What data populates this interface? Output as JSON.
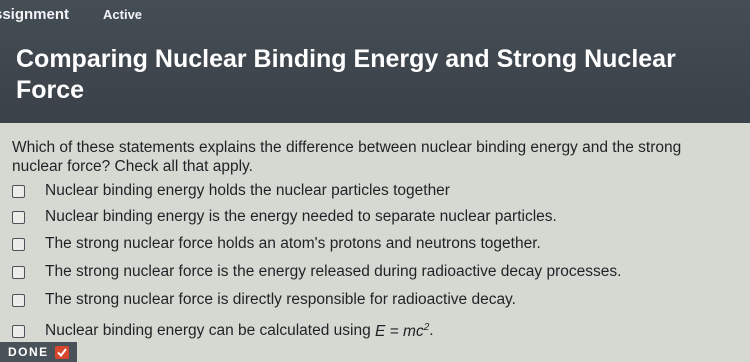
{
  "header": {
    "breadcrumb": "ssignment",
    "status": "Active",
    "title": "Comparing Nuclear Binding Energy and Strong Nuclear Force"
  },
  "question": "Which of these statements explains the difference between nuclear binding energy and the strong nuclear force? Check all that apply.",
  "options": [
    {
      "label": "Nuclear binding energy holds the nuclear particles together",
      "checked": false
    },
    {
      "label": "Nuclear binding energy is the energy needed to separate nuclear particles.",
      "checked": false
    },
    {
      "label": "The strong nuclear force holds an atom's protons and neutrons together.",
      "checked": false
    },
    {
      "label": "The strong nuclear force is the energy released during radioactive decay processes.",
      "checked": false
    },
    {
      "label": "The strong nuclear force is directly responsible for radioactive decay.",
      "checked": false
    },
    {
      "label": "Nuclear binding energy can be calculated using",
      "equation": {
        "lhs": "E = mc",
        "exp": "2"
      },
      "suffix": ".",
      "checked": false
    }
  ],
  "done_button": {
    "label": "DONE",
    "icon": "check-icon",
    "accent": "#d8462e"
  }
}
